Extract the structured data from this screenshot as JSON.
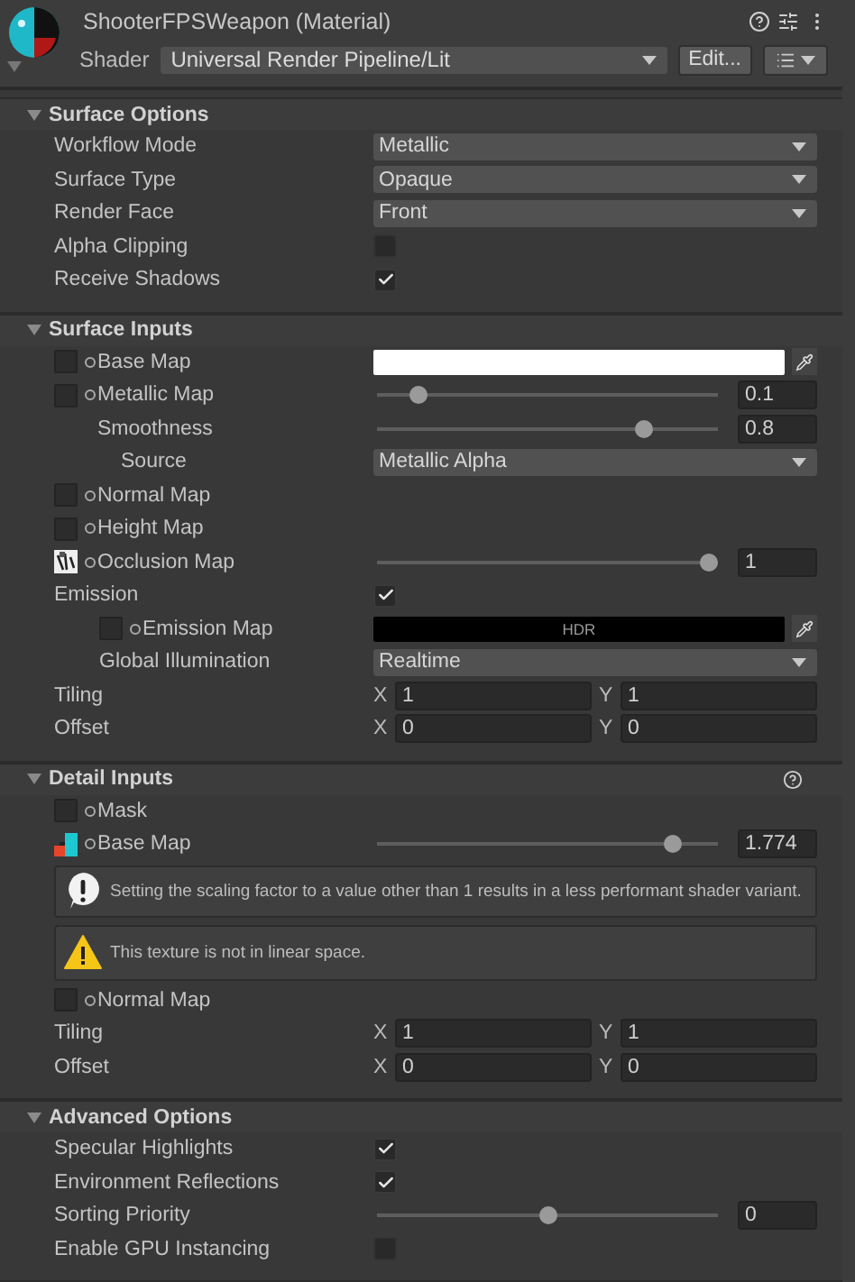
{
  "header": {
    "title": "ShooterFPSWeapon (Material)",
    "shader_label": "Shader",
    "shader": "Universal Render Pipeline/Lit",
    "edit_button": "Edit..."
  },
  "sections": [
    {
      "title": "Surface Options",
      "expanded": true,
      "help_icon": false,
      "rows": [
        {
          "kind": "dropdown",
          "label": "Workflow Mode",
          "value": "Metallic"
        },
        {
          "kind": "dropdown",
          "label": "Surface Type",
          "value": "Opaque"
        },
        {
          "kind": "dropdown",
          "label": "Render Face",
          "value": "Front"
        },
        {
          "kind": "checkbox",
          "label": "Alpha Clipping",
          "checked": false
        },
        {
          "kind": "checkbox",
          "label": "Receive Shadows",
          "checked": true
        }
      ]
    },
    {
      "title": "Surface Inputs",
      "expanded": true,
      "help_icon": false,
      "rows": [
        {
          "kind": "texture",
          "label": "Base Map",
          "control": {
            "kind": "color",
            "color": "#ffffff"
          }
        },
        {
          "kind": "texture",
          "label": "Metallic Map",
          "control": {
            "kind": "slider",
            "level": 0.1,
            "value": "0.1"
          },
          "children": [
            {
              "kind": "slider",
              "label": "Smoothness",
              "level": 0.8,
              "value": "0.8",
              "children": [
                {
                  "kind": "dropdown",
                  "label": "Source",
                  "value": "Metallic Alpha"
                }
              ]
            }
          ]
        },
        {
          "kind": "texture",
          "label": "Normal Map"
        },
        {
          "kind": "texture",
          "label": "Height Map"
        },
        {
          "kind": "texture",
          "label": "Occlusion Map",
          "thumbnail": {
            "kind": "grayscale"
          },
          "control": {
            "kind": "slider",
            "level": 1,
            "value": "1"
          }
        },
        {
          "kind": "checkbox",
          "label": "Emission",
          "checked": true,
          "children": [
            {
              "kind": "texture",
              "label": "Emission Map",
              "control": {
                "kind": "hdr",
                "text": "HDR",
                "color": "#000000"
              }
            },
            {
              "kind": "dropdown",
              "label": "Global Illumination",
              "value": "Realtime"
            }
          ]
        },
        {
          "kind": "vector",
          "label": "Tiling",
          "components": [
            {
              "axis": "X",
              "value": "1"
            },
            {
              "axis": "Y",
              "value": "1"
            }
          ]
        },
        {
          "kind": "vector",
          "label": "Offset",
          "components": [
            {
              "axis": "X",
              "value": "0"
            },
            {
              "axis": "Y",
              "value": "0"
            }
          ]
        }
      ]
    },
    {
      "title": "Detail Inputs",
      "expanded": true,
      "help_icon": true,
      "rows": [
        {
          "kind": "texture",
          "label": "Mask"
        },
        {
          "kind": "texture",
          "label": "Base Map",
          "thumbnail": {
            "kind": "colored"
          },
          "control": {
            "kind": "slider",
            "level": 0.887,
            "value": "1.774"
          }
        },
        {
          "kind": "info",
          "text": "Setting the scaling factor to a value other than 1 results in a less performant shader variant."
        },
        {
          "kind": "warning",
          "text": "This texture is not in linear space."
        },
        {
          "kind": "texture",
          "label": "Normal Map"
        },
        {
          "kind": "vector",
          "label": "Tiling",
          "components": [
            {
              "axis": "X",
              "value": "1"
            },
            {
              "axis": "Y",
              "value": "1"
            }
          ]
        },
        {
          "kind": "vector",
          "label": "Offset",
          "components": [
            {
              "axis": "X",
              "value": "0"
            },
            {
              "axis": "Y",
              "value": "0"
            }
          ]
        }
      ]
    },
    {
      "title": "Advanced Options",
      "expanded": true,
      "help_icon": false,
      "rows": [
        {
          "kind": "checkbox",
          "label": "Specular Highlights",
          "checked": true
        },
        {
          "kind": "checkbox",
          "label": "Environment Reflections",
          "checked": true
        },
        {
          "kind": "slider",
          "label": "Sorting Priority",
          "level": 0.5,
          "value": "0"
        },
        {
          "kind": "checkbox",
          "label": "Enable GPU Instancing",
          "checked": false
        }
      ]
    }
  ]
}
